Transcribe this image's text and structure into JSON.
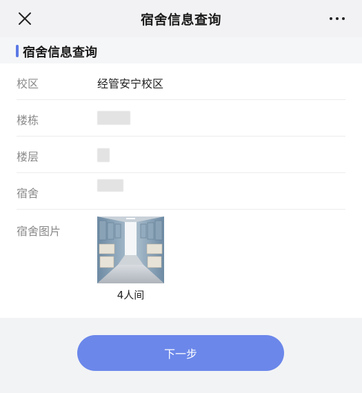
{
  "navbar": {
    "title": "宿舍信息查询",
    "close_icon": "close-icon",
    "more_icon": "more-icon"
  },
  "section": {
    "title": "宿舍信息查询"
  },
  "fields": {
    "campus": {
      "label": "校区",
      "value": "经管安宁校区"
    },
    "building": {
      "label": "楼栋",
      "value": ""
    },
    "floor": {
      "label": "楼层",
      "value": ""
    },
    "dorm": {
      "label": "宿舍",
      "value": ""
    },
    "photo": {
      "label": "宿舍图片",
      "caption": "4人间"
    }
  },
  "actions": {
    "next_label": "下一步"
  },
  "colors": {
    "accent": "#5b79e4",
    "button": "#6b87ea",
    "background": "#f2f3f5"
  }
}
